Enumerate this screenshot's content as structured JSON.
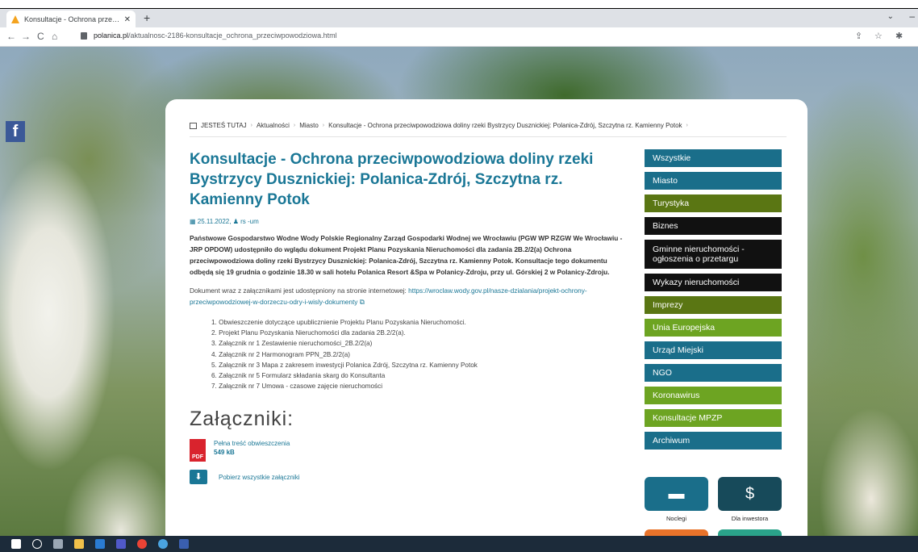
{
  "browser": {
    "tab_title": "Konsultacje - Ochrona przeciwpowodziowa",
    "tab_close": "✕",
    "new_tab": "+",
    "tab_menu": "⌄",
    "window_min": "–",
    "back": "←",
    "forward": "→",
    "reload": "C",
    "home": "⌂",
    "url_host": "polanica.pl",
    "url_path": "/aktualnosc-2186-konsultacje_ochrona_przeciwpowodziowa.html",
    "share": "⇪",
    "bookmark": "☆",
    "extensions": "✱"
  },
  "facebook": "f",
  "breadcrumb": {
    "you_are_here": "JESTEŚ TUTAJ",
    "items": [
      "Aktualności",
      "Miasto",
      "Konsultacje - Ochrona przeciwpowodziowa doliny rzeki Bystrzycy Dusznickiej: Polanica-Zdrój, Szczytna rz. Kamienny Potok"
    ],
    "sep": "›"
  },
  "article": {
    "title": "Konsultacje - Ochrona przeciwpowodziowa doliny rzeki Bystrzycy Dusznickiej: Polanica-Zdrój, Szczytna rz. Kamienny Potok",
    "date": "25.11.2022,",
    "author": "rs -um",
    "lead": "Państwowe Gospodarstwo Wodne Wody Polskie Regionalny Zarząd Gospodarki Wodnej we Wrocławiu (PGW WP RZGW We Wrocławiu - JRP OPDOW) udostępniło do wglądu dokument Projekt Planu Pozyskania Nieruchomości dla zadania 2B.2/2(a) Ochrona przeciwpowodziowa doliny rzeki Bystrzycy Dusznickiej: Polanica-Zdrój, Szczytna rz. Kamienny Potok. Konsultacje tego dokumentu odbędą się 19 grudnia o godzinie 18.30 w sali hotelu Polanica Resort &Spa w Polanicy-Zdroju, przy ul. Górskiej 2 w Polanicy-Zdroju.",
    "body_prefix": "Dokument wraz z załącznikami jest udostępniony na stronie internetowej: ",
    "body_link": "https://wroclaw.wody.gov.pl/nasze-dzialania/projekt-ochrony-przeciwpowodziowej-w-dorzeczu-odry-i-wisly-dokumenty",
    "list": [
      "1. Obwieszczenie dotyczące upublicznienie Projektu Planu Pozyskania Nieruchomości.",
      "2. Projekt Planu Pozyskania Nieruchomości dla zadania 2B.2/2(a).",
      "3. Załącznik nr 1 Zestawienie nieruchomości_2B.2/2(a)",
      "4. Załącznik nr 2 Harmonogram PPN_2B.2/2(a)",
      "5. Załącznik nr 3 Mapa z zakresem inwestycji Polanica Zdrój, Szczytna rz. Kamienny Potok",
      "6. Załącznik nr 5 Formularz składania skarg do Konsultanta",
      "7. Załącznik nr 7 Umowa - czasowe zajęcie nieruchomości"
    ],
    "attachments_title": "Załączniki:",
    "attachment_name": "Pełna treść obwieszczenia",
    "attachment_size": "549 kB",
    "pdf_label": "PDF",
    "download_all": "Pobierz wszystkie załączniki"
  },
  "sidebar": {
    "items": [
      {
        "label": "Wszystkie",
        "color": "#1a6e8a"
      },
      {
        "label": "Miasto",
        "color": "#1a6e8a"
      },
      {
        "label": "Turystyka",
        "color": "#5a7613"
      },
      {
        "label": "Biznes",
        "color": "#111111"
      },
      {
        "label": "Gminne nieruchomości - ogłoszenia o przetargu",
        "color": "#111111"
      },
      {
        "label": "Wykazy nieruchomości",
        "color": "#111111"
      },
      {
        "label": "Imprezy",
        "color": "#5a7613"
      },
      {
        "label": "Unia Europejska",
        "color": "#6da422"
      },
      {
        "label": "Urząd Miejski",
        "color": "#1a6e8a"
      },
      {
        "label": "NGO",
        "color": "#1a6e8a"
      },
      {
        "label": "Koronawirus",
        "color": "#6da422"
      },
      {
        "label": "Konsultacje MPZP",
        "color": "#6da422"
      },
      {
        "label": "Archiwum",
        "color": "#1a6e8a"
      }
    ],
    "tiles": [
      {
        "label": "Noclegi",
        "icon": "bed-icon",
        "glyph": "🛏"
      },
      {
        "label": "Dla inwestora",
        "icon": "money-icon",
        "glyph": "$"
      }
    ]
  }
}
